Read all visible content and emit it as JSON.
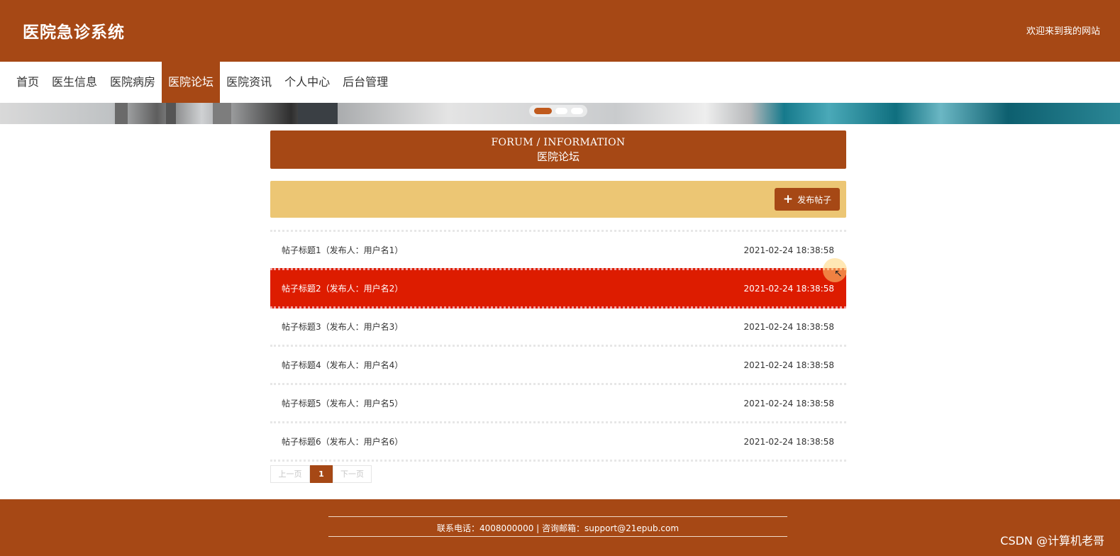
{
  "header": {
    "title": "医院急诊系统",
    "welcome": "欢迎来到我的网站"
  },
  "nav": {
    "items": [
      {
        "label": "首页"
      },
      {
        "label": "医生信息"
      },
      {
        "label": "医院病房"
      },
      {
        "label": "医院论坛"
      },
      {
        "label": "医院资讯"
      },
      {
        "label": "个人中心"
      },
      {
        "label": "后台管理"
      }
    ],
    "active_index": 3
  },
  "banner": {
    "slide_count": 3,
    "active_slide": 0
  },
  "section": {
    "title_en": "FORUM / INFORMATION",
    "title_cn": "医院论坛"
  },
  "toolbar": {
    "publish_label": "发布帖子",
    "publish_icon": "plus-icon"
  },
  "posts": [
    {
      "title": "帖子标题1（发布人：用户名1）",
      "time": "2021-02-24 18:38:58"
    },
    {
      "title": "帖子标题2（发布人：用户名2）",
      "time": "2021-02-24 18:38:58"
    },
    {
      "title": "帖子标题3（发布人：用户名3）",
      "time": "2021-02-24 18:38:58"
    },
    {
      "title": "帖子标题4（发布人：用户名4）",
      "time": "2021-02-24 18:38:58"
    },
    {
      "title": "帖子标题5（发布人：用户名5）",
      "time": "2021-02-24 18:38:58"
    },
    {
      "title": "帖子标题6（发布人：用户名6）",
      "time": "2021-02-24 18:38:58"
    }
  ],
  "pagination": {
    "prev": "上一页",
    "current": "1",
    "next": "下一页"
  },
  "footer": {
    "contact": "联系电话：4008000000 | 咨询邮箱：support@21epub.com",
    "watermark": "CSDN @计算机老哥"
  },
  "colors": {
    "brand": "#a64815",
    "toolbar_bg": "#ecc674",
    "hover_row": "#dd1c00"
  }
}
